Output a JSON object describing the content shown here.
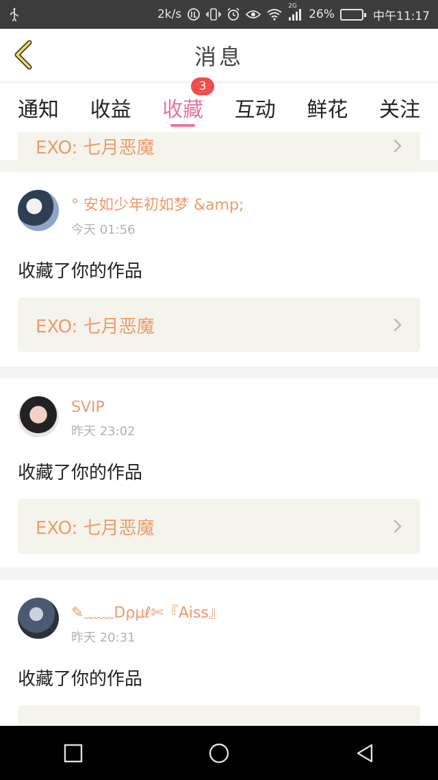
{
  "status_bar": {
    "speed": "2k/s",
    "network": "2G",
    "battery": "26%",
    "battery_level": 0.26,
    "time": "中午11:17",
    "icons": [
      "usb-icon",
      "volte-icon",
      "vibrate-icon",
      "alarm-icon",
      "eye-icon",
      "wifi-icon",
      "signal-icon",
      "battery-icon"
    ]
  },
  "header": {
    "title": "消息",
    "back_icon": "chevron-left-icon"
  },
  "tabs": [
    {
      "label": "通知"
    },
    {
      "label": "收益"
    },
    {
      "label": "收藏",
      "badge": "3",
      "active": true
    },
    {
      "label": "互动"
    },
    {
      "label": "鲜花"
    },
    {
      "label": "关注"
    }
  ],
  "feed": {
    "partial_top": {
      "work_title": "EXO: 七月恶魔"
    },
    "items": [
      {
        "user_name": "° 安如少年初如梦 &amp;",
        "time": "今天 01:56",
        "action": "收藏了你的作品",
        "work_title": "EXO: 七月恶魔"
      },
      {
        "user_name": "SVIP",
        "time": "昨天 23:02",
        "action": "收藏了你的作品",
        "work_title": "EXO: 七月恶魔"
      },
      {
        "user_name": "✎﹏﹏Dρμℓ✄『Aiss』",
        "time": "昨天 20:31",
        "action": "收藏了你的作品"
      }
    ]
  },
  "nav_bar": {
    "icons": [
      "recent-apps-icon",
      "home-icon",
      "back-icon"
    ]
  },
  "colors": {
    "accent": "#e8759d",
    "name": "#ee9a6a",
    "badge": "#f24c4c",
    "link_bg": "#f4f4ec"
  }
}
